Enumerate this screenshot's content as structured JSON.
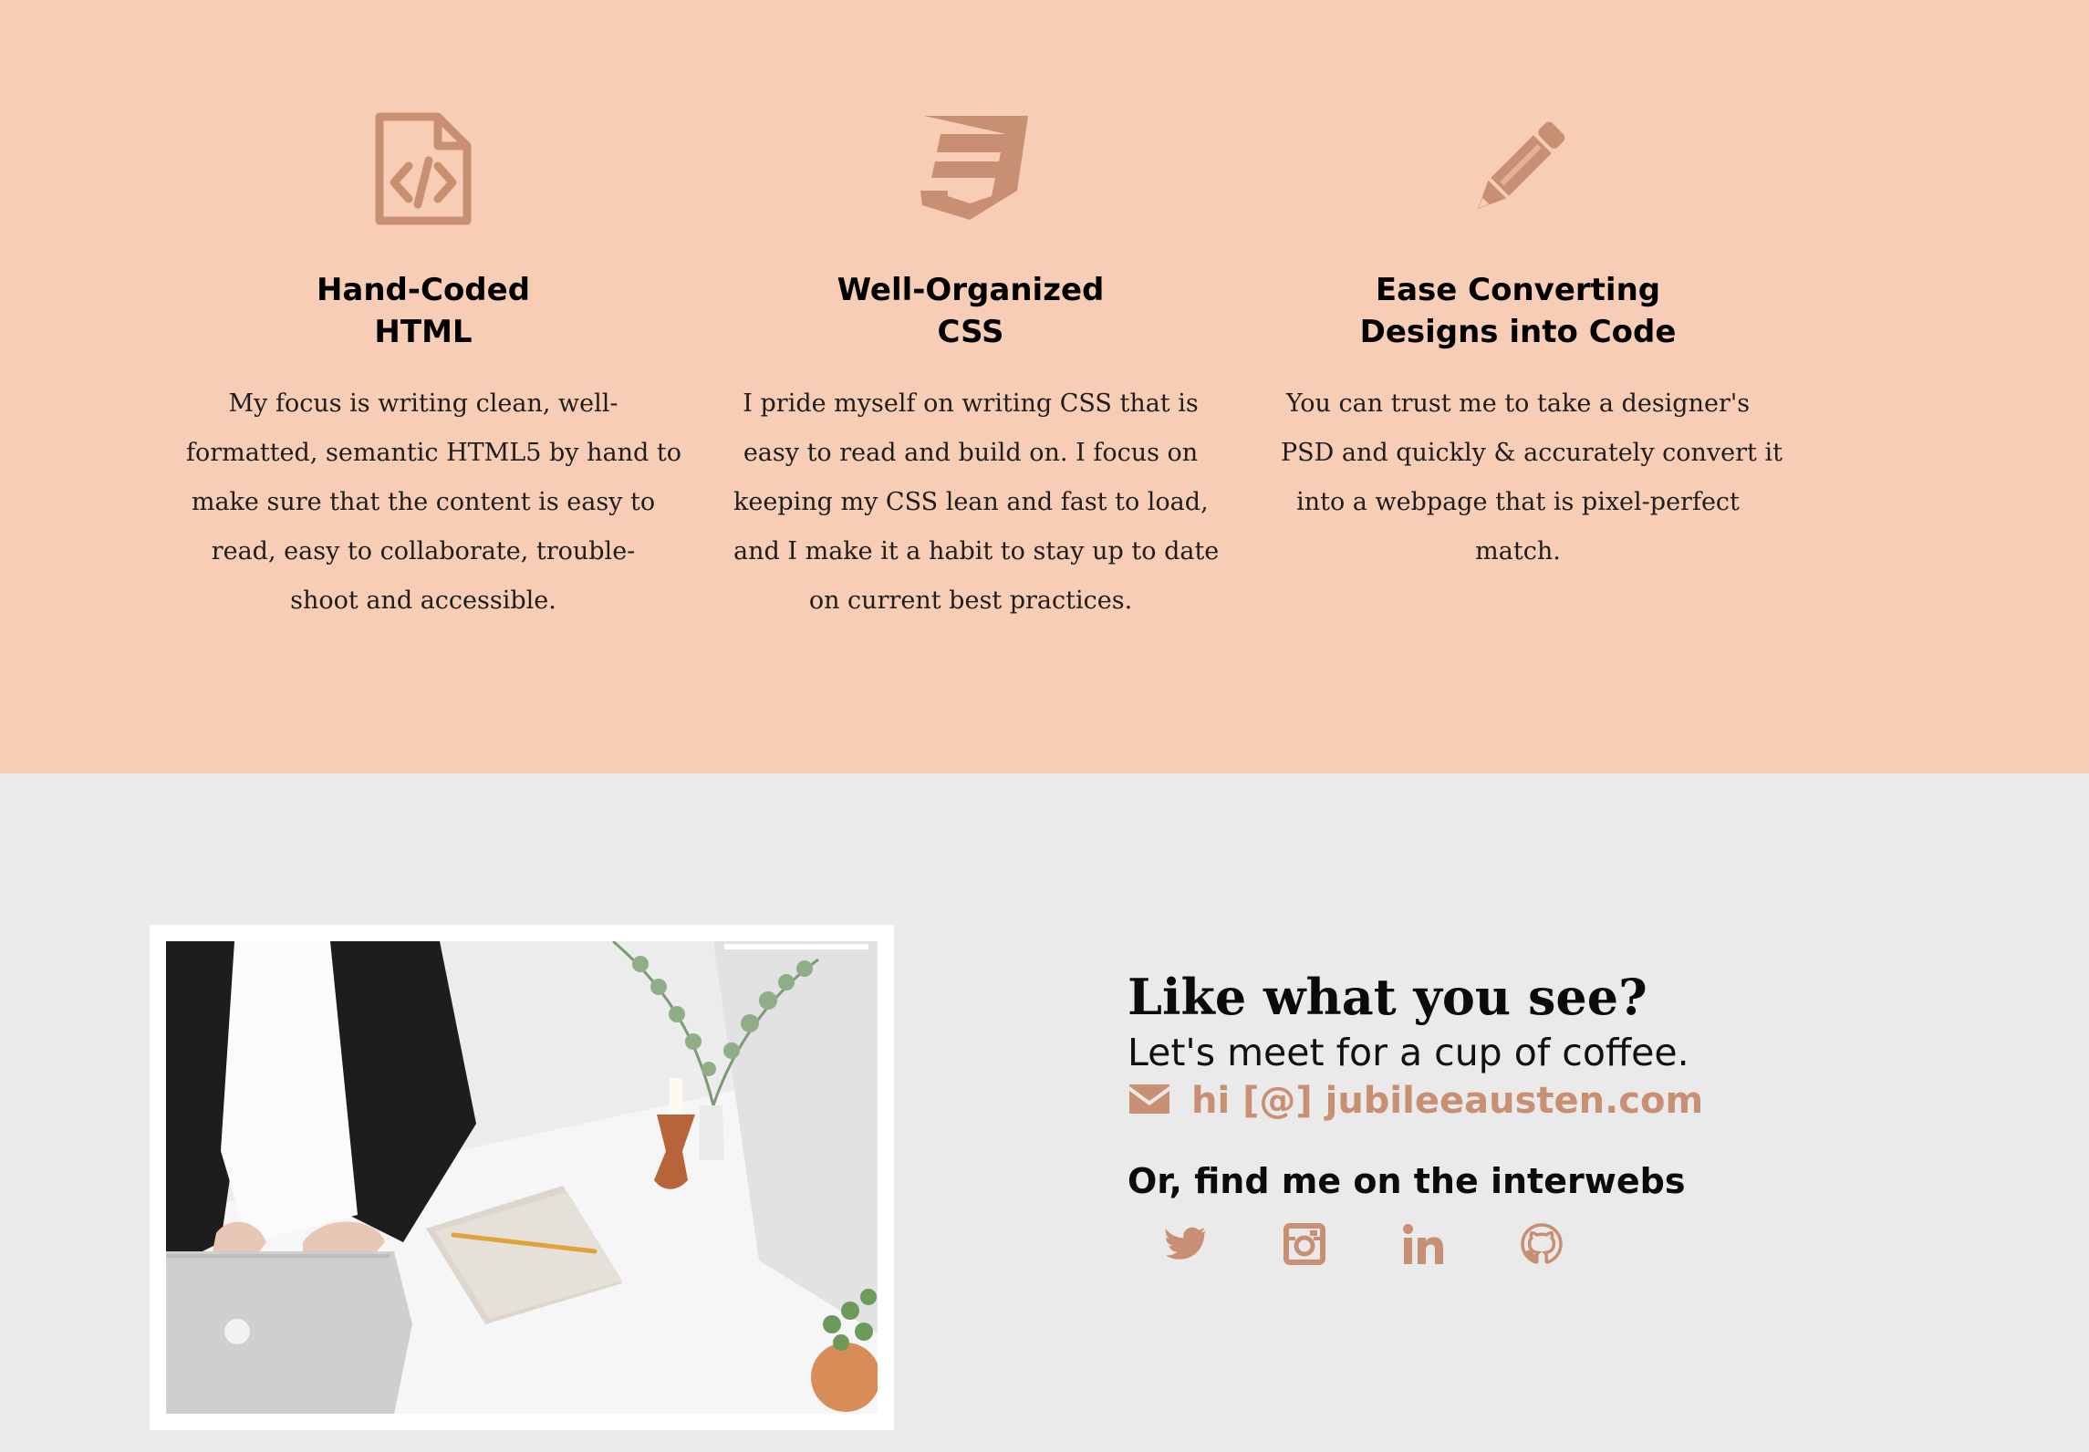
{
  "colors": {
    "accent": "#c98f72",
    "skills_background": "#f8cdb5",
    "contact_background": "#ebeaea"
  },
  "skills": [
    {
      "icon": "html-file-code-icon",
      "title_lines": [
        "Hand-Coded",
        "HTML"
      ],
      "body_lines": [
        "My focus is writing clean, well-",
        "formatted, semantic HTML5 by hand to",
        "make sure that the content is easy to",
        "read, easy to collaborate, trouble-",
        "shoot and accessible."
      ]
    },
    {
      "icon": "css3-icon",
      "title_lines": [
        "Well-Organized",
        "CSS"
      ],
      "body_lines": [
        "I pride myself on writing CSS that is",
        "easy to read and build on. I focus on",
        "keeping my CSS lean and fast to load,",
        "and I make it a habit to stay up to date",
        "on current best practices."
      ]
    },
    {
      "icon": "pencil-icon",
      "title_lines": [
        "Ease Converting",
        "Designs into Code"
      ],
      "body_lines": [
        "You can trust me to take a designer's",
        "PSD and quickly & accurately convert it",
        "into a webpage that is pixel-perfect",
        "match."
      ]
    }
  ],
  "contact": {
    "heading": "Like what you see?",
    "subheading": "Let's meet for a cup of coffee.",
    "email_icon": "envelope-icon",
    "email_text": "hi [@] jubileeausten.com",
    "social_heading": "Or, find me on the interwebs",
    "social_links": [
      {
        "icon": "twitter-icon"
      },
      {
        "icon": "instagram-icon"
      },
      {
        "icon": "linkedin-icon"
      },
      {
        "icon": "github-icon"
      }
    ]
  }
}
